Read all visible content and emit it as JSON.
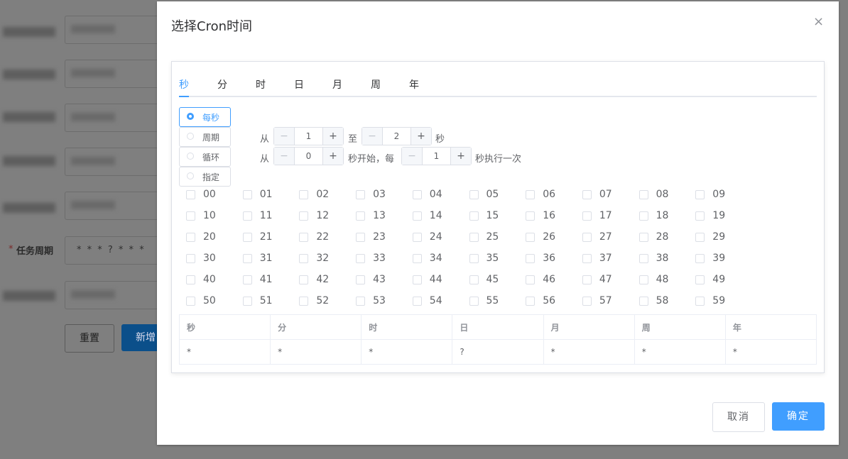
{
  "background": {
    "required_mark": "*",
    "task_label": "任务周期",
    "task_value": "* * * ? * * *",
    "reset_label": "重置",
    "add_label": "新增"
  },
  "dialog": {
    "title": "选择Cron时间",
    "close_glyph": "×",
    "tabs": [
      "秒",
      "分",
      "时",
      "日",
      "月",
      "周",
      "年"
    ],
    "active_tab": "秒",
    "options": {
      "every": "每秒",
      "period": "周期",
      "loop": "循环",
      "specify": "指定"
    },
    "period_row": {
      "from": "从",
      "start": "1",
      "to": "至",
      "end": "2",
      "unit": "秒"
    },
    "loop_row": {
      "from": "从",
      "start": "0",
      "mid": "秒开始，每",
      "step": "1",
      "tail": "秒执行一次"
    },
    "stepper_minus": "−",
    "stepper_plus": "+",
    "table_headers": [
      "秒",
      "分",
      "时",
      "日",
      "月",
      "周",
      "年"
    ],
    "table_values": [
      "*",
      "*",
      "*",
      "?",
      "*",
      "*",
      "*"
    ],
    "cancel_label": "取消",
    "ok_label": "确定"
  },
  "colors": {
    "accent": "#409eff",
    "overlay": "#7f7f7f"
  }
}
